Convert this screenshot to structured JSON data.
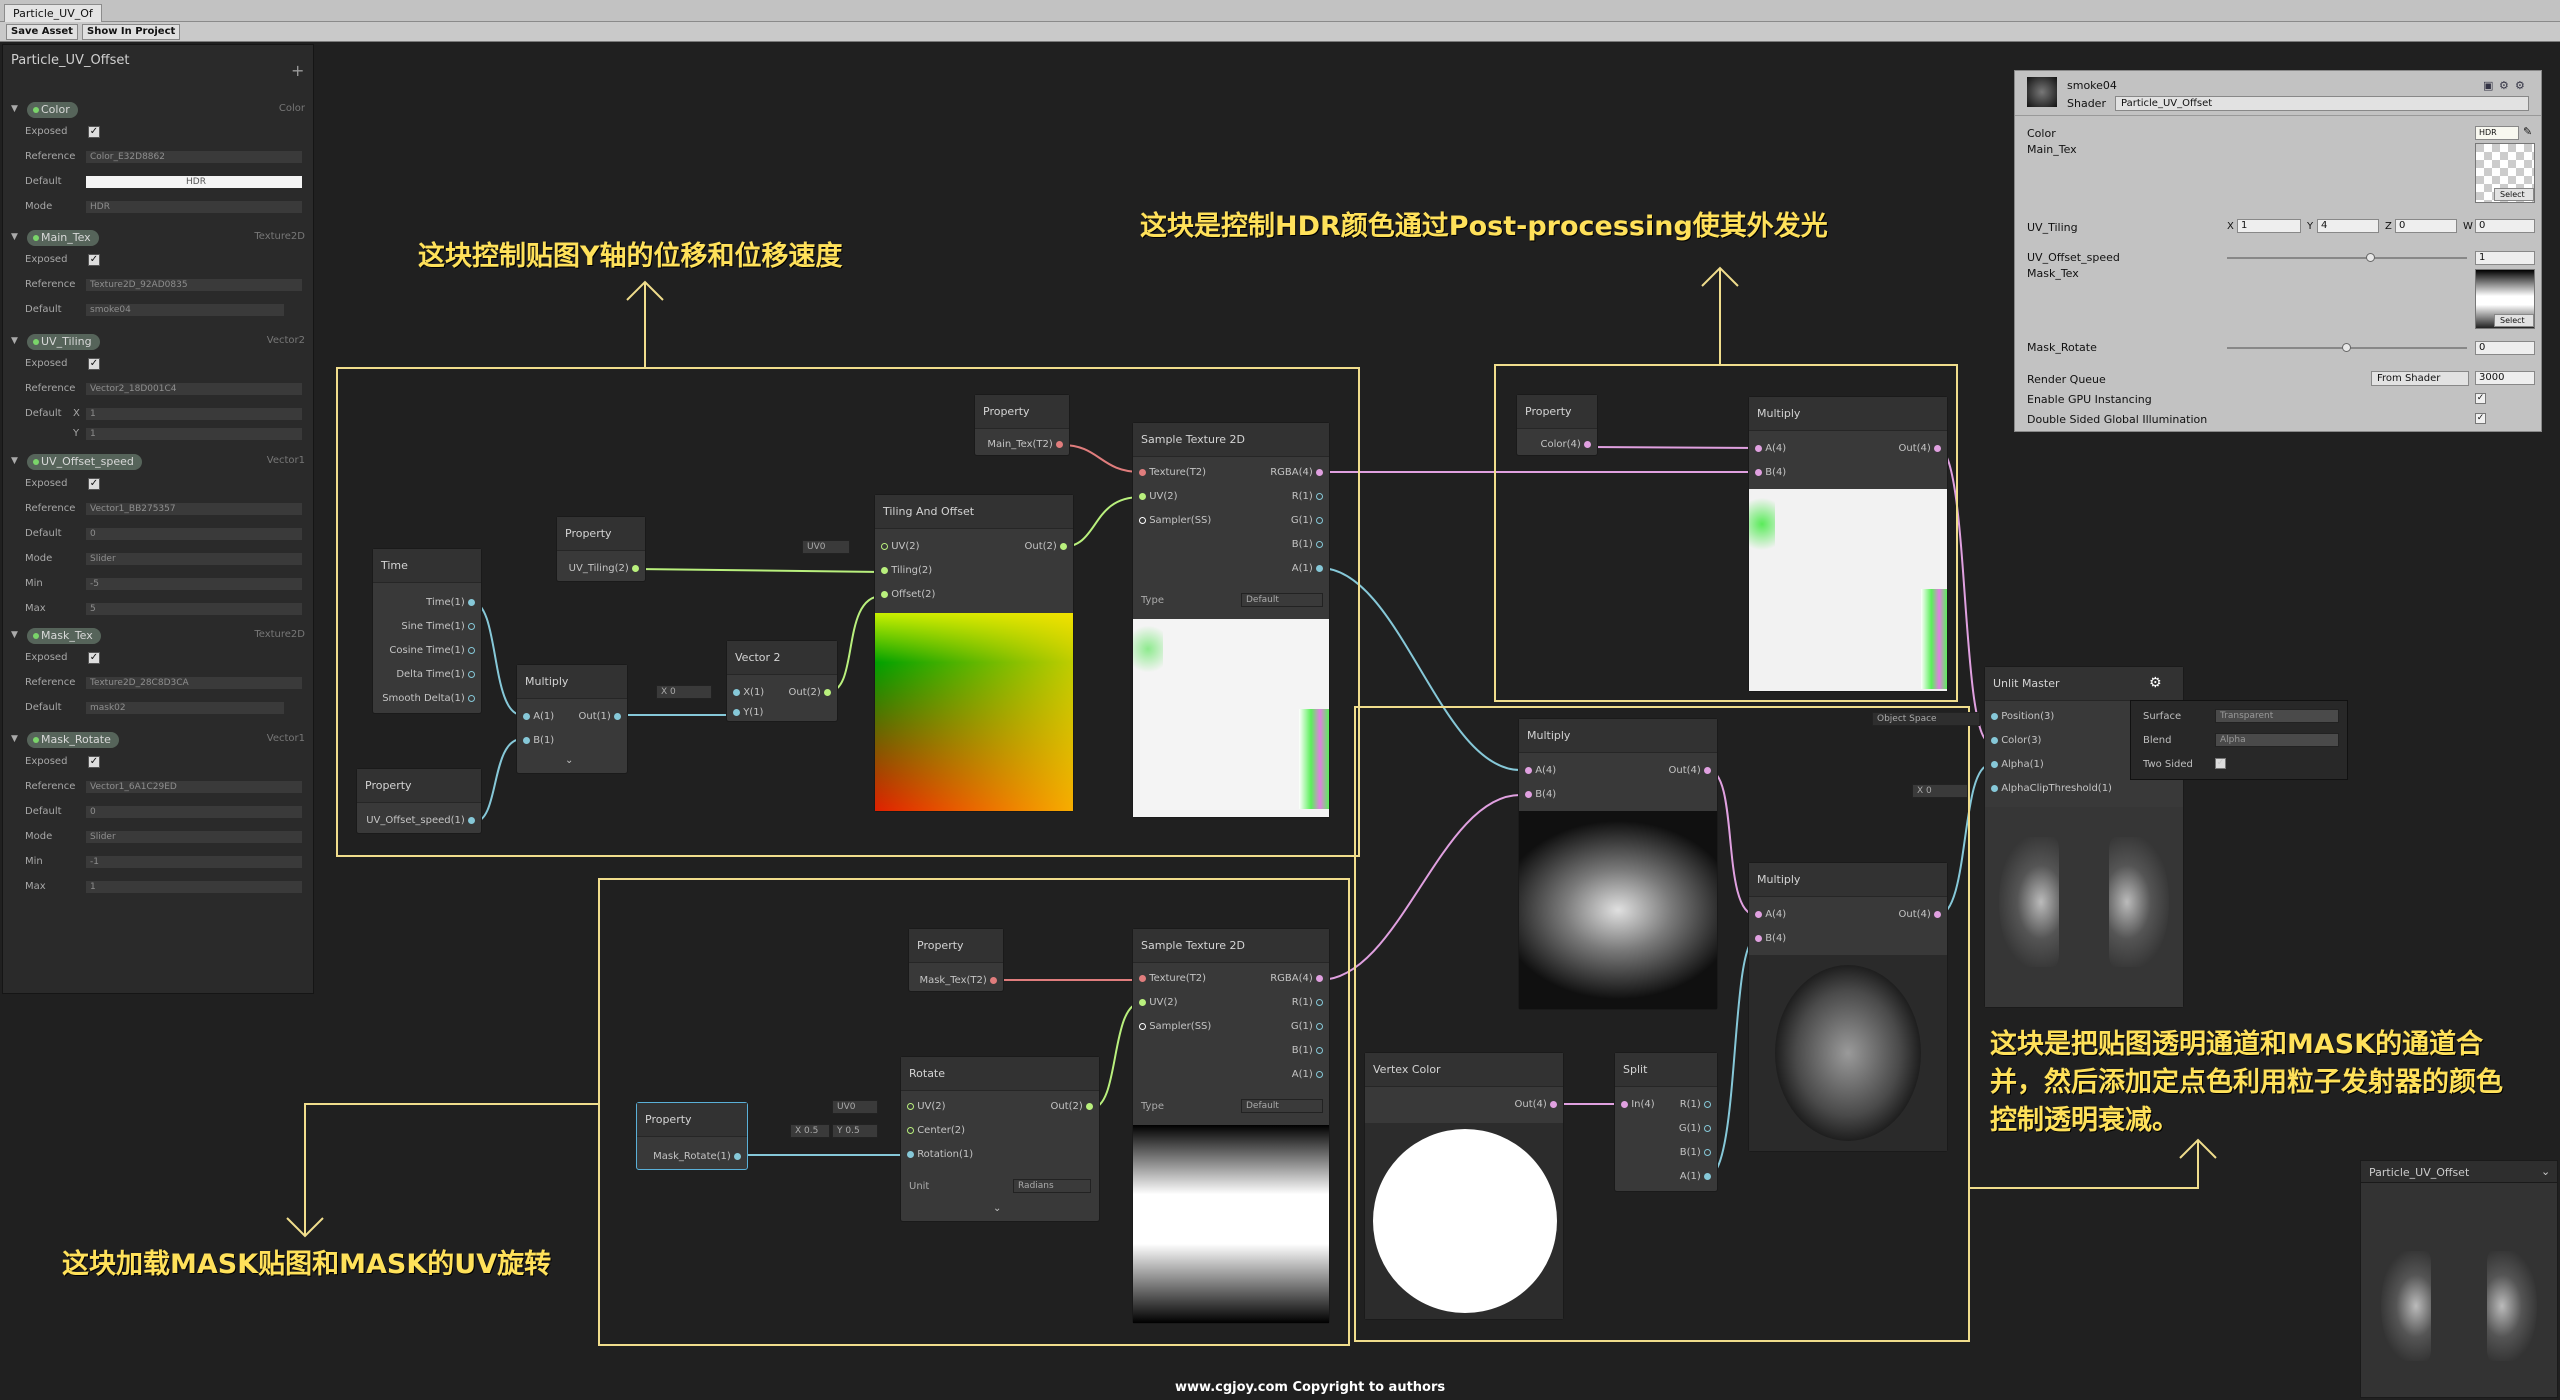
{
  "window": {
    "tab_title": "Particle_UV_Of"
  },
  "toolbar": {
    "save_asset": "Save Asset",
    "show_in_project": "Show In Project"
  },
  "blackboard": {
    "title": "Particle_UV_Offset",
    "add": "+",
    "properties": [
      {
        "name": "Color",
        "type": "Color",
        "exposed": "✓",
        "reference": "Color_E32D8862",
        "default": "HDR",
        "mode": "HDR"
      },
      {
        "name": "Main_Tex",
        "type": "Texture2D",
        "exposed": "✓",
        "reference": "Texture2D_92AD0835",
        "default": "smoke04"
      },
      {
        "name": "UV_Tiling",
        "type": "Vector2",
        "exposed": "✓",
        "reference": "Vector2_18D001C4",
        "default_x": "1",
        "default_y": "1"
      },
      {
        "name": "UV_Offset_speed",
        "type": "Vector1",
        "exposed": "✓",
        "reference": "Vector1_BB275357",
        "default": "0",
        "mode": "Slider",
        "min": "-5",
        "max": "5"
      },
      {
        "name": "Mask_Tex",
        "type": "Texture2D",
        "exposed": "✓",
        "reference": "Texture2D_28C8D3CA",
        "default": "mask02"
      },
      {
        "name": "Mask_Rotate",
        "type": "Vector1",
        "exposed": "✓",
        "reference": "Vector1_6A1C29ED",
        "default": "0",
        "mode": "Slider",
        "min": "-1",
        "max": "1"
      }
    ],
    "labels": {
      "exposed": "Exposed",
      "reference": "Reference",
      "default": "Default",
      "mode": "Mode",
      "min": "Min",
      "max": "Max",
      "x": "X",
      "y": "Y"
    }
  },
  "nodes": {
    "time": {
      "title": "Time",
      "ports": [
        "Time(1)",
        "Sine Time(1)",
        "Cosine Time(1)",
        "Delta Time(1)",
        "Smooth Delta(1)"
      ]
    },
    "prop_speed": {
      "title": "Property",
      "out": "UV_Offset_speed(1)"
    },
    "mult1": {
      "title": "Multiply",
      "a": "A(1)",
      "b": "B(1)",
      "out": "Out(1)"
    },
    "prop_tiling": {
      "title": "Property",
      "out": "UV_Tiling(2)"
    },
    "vec2": {
      "title": "Vector 2",
      "x": "X(1)",
      "y": "Y(1)",
      "out": "Out(2)",
      "x_field": "X  0"
    },
    "tiling": {
      "title": "Tiling And Offset",
      "uv": "UV(2)",
      "tiling": "Tiling(2)",
      "offset": "Offset(2)",
      "out": "Out(2)",
      "uv_field": "UV0"
    },
    "prop_main": {
      "title": "Property",
      "out": "Main_Tex(T2)"
    },
    "sample1": {
      "title": "Sample Texture 2D",
      "in": [
        "Texture(T2)",
        "UV(2)",
        "Sampler(SS)"
      ],
      "out": [
        "RGBA(4)",
        "R(1)",
        "G(1)",
        "B(1)",
        "A(1)"
      ],
      "type_label": "Type",
      "type_value": "Default"
    },
    "prop_color": {
      "title": "Property",
      "out": "Color(4)"
    },
    "mult_color": {
      "title": "Multiply",
      "a": "A(4)",
      "b": "B(4)",
      "out": "Out(4)"
    },
    "mult_alpha": {
      "title": "Multiply",
      "a": "A(4)",
      "b": "B(4)",
      "out": "Out(4)"
    },
    "mult_vc": {
      "title": "Multiply",
      "a": "A(4)",
      "b": "B(4)",
      "out": "Out(4)"
    },
    "prop_mask": {
      "title": "Property",
      "out": "Mask_Tex(T2)"
    },
    "sample2": {
      "title": "Sample Texture 2D",
      "in": [
        "Texture(T2)",
        "UV(2)",
        "Sampler(SS)"
      ],
      "out": [
        "RGBA(4)",
        "R(1)",
        "G(1)",
        "B(1)",
        "A(1)"
      ],
      "type_label": "Type",
      "type_value": "Default"
    },
    "rotate": {
      "title": "Rotate",
      "in": [
        "UV(2)",
        "Center(2)",
        "Rotation(1)"
      ],
      "out": "Out(2)",
      "unit_label": "Unit",
      "unit_value": "Radians",
      "uv_field": "UV0",
      "center_x": "X  0.5",
      "center_y": "Y  0.5"
    },
    "prop_rotate": {
      "title": "Property",
      "out": "Mask_Rotate(1)"
    },
    "vertex": {
      "title": "Vertex Color",
      "out": "Out(4)"
    },
    "split": {
      "title": "Split",
      "in": "In(4)",
      "out": [
        "R(1)",
        "G(1)",
        "B(1)",
        "A(1)"
      ]
    },
    "master": {
      "title": "Unlit Master",
      "space": "Object Space",
      "in": [
        "Position(3)",
        "Color(3)",
        "Alpha(1)",
        "AlphaClipThreshold(1)"
      ],
      "clip_field": "X  0"
    }
  },
  "master_settings": {
    "surface_label": "Surface",
    "surface": "Transparent",
    "blend_label": "Blend",
    "blend": "Alpha",
    "two_sided": "Two Sided"
  },
  "annotations": {
    "a1": "这块控制贴图Y轴的位移和位移速度",
    "a2": "这块是控制HDR颜色通过Post-processing使其外发光",
    "a3": "这块加载MASK贴图和MASK的UV旋转",
    "a4": "这块是把贴图透明通道和MASK的通道合并，然后添加定点色利用粒子发射器的颜色控制透明衰减。"
  },
  "inspector": {
    "material": "smoke04",
    "shader_label": "Shader",
    "shader": "Particle_UV_Offset",
    "color": "Color",
    "hdr": "HDR",
    "main_tex": "Main_Tex",
    "select": "Select",
    "uv_tiling": "UV_Tiling",
    "tiling": {
      "x": "1",
      "y": "4",
      "z": "0",
      "w": "0"
    },
    "uv_offset_speed": "UV_Offset_speed",
    "speed_value": "1",
    "speed_fraction": 0.6,
    "mask_tex": "Mask_Tex",
    "mask_rotate": "Mask_Rotate",
    "rotate_value": "0",
    "rotate_fraction": 0.5,
    "render_queue": "Render Queue",
    "queue_mode": "From Shader",
    "queue_value": "3000",
    "gpu": "Enable GPU Instancing",
    "dsgi": "Double Sided Global Illumination"
  },
  "mini_preview": {
    "title": "Particle_UV_Offset"
  },
  "footer": "www.cgjoy.com Copyright to authors"
}
